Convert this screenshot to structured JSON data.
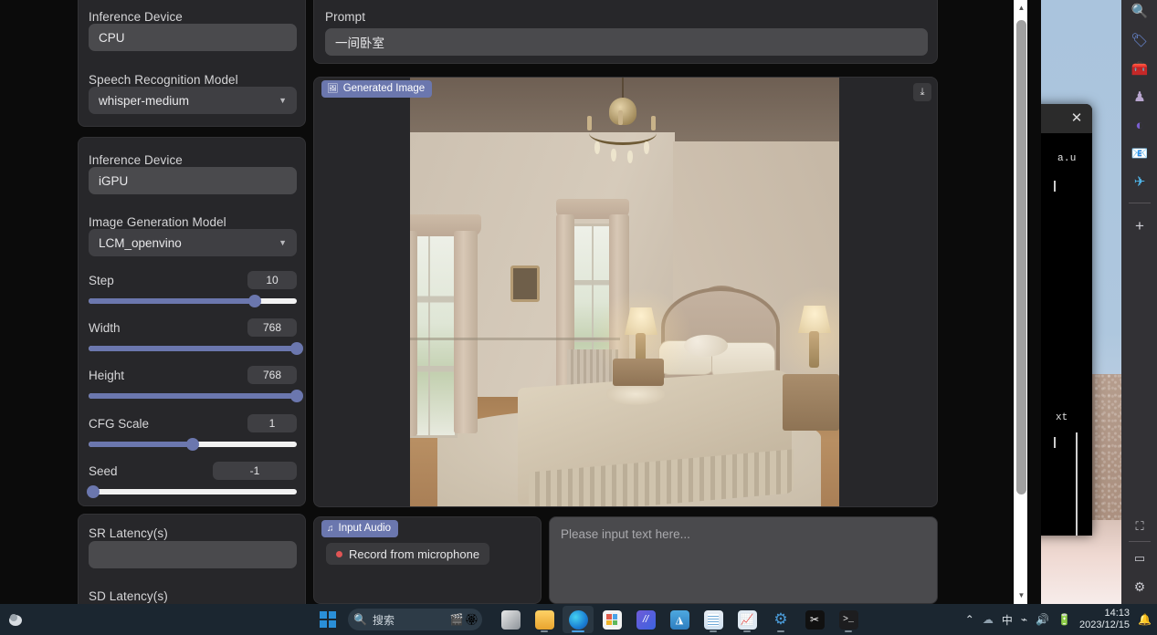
{
  "app": {
    "speech_panel": {
      "device_label": "Inference Device",
      "device_value": "CPU",
      "model_label": "Speech Recognition Model",
      "model_value": "whisper-medium"
    },
    "image_panel": {
      "device_label": "Inference Device",
      "device_value": "iGPU",
      "model_label": "Image Generation Model",
      "model_value": "LCM_openvino",
      "sliders": [
        {
          "label": "Step",
          "value": "10",
          "fill_pct": 80,
          "name": "step"
        },
        {
          "label": "Width",
          "value": "768",
          "fill_pct": 100,
          "name": "width"
        },
        {
          "label": "Height",
          "value": "768",
          "fill_pct": 100,
          "name": "height"
        },
        {
          "label": "CFG Scale",
          "value": "1",
          "fill_pct": 50,
          "name": "cfg-scale"
        },
        {
          "label": "Seed",
          "value": "-1",
          "fill_pct": 2,
          "name": "seed"
        }
      ]
    },
    "latency_panel": {
      "sr_label": "SR Latency(s)",
      "sr_value": "",
      "sd_label": "SD Latency(s)"
    },
    "prompt": {
      "label": "Prompt",
      "value": "一间卧室"
    },
    "generated_image": {
      "badge": "Generated Image",
      "badge_icon": "image-icon",
      "download_icon": "download-icon",
      "alt": "Classical beige bedroom with chandelier, two curtained windows, ornate wooden bed, table lamps and patterned rug"
    },
    "audio": {
      "badge": "Input Audio",
      "badge_icon": "music-note-icon",
      "record_label": "Record from microphone"
    },
    "textbox": {
      "placeholder": "Please input text here..."
    }
  },
  "bg_window": {
    "close_icon": "close-icon",
    "line1": "a.u",
    "line2": "xt"
  },
  "edge_sidebar": {
    "items": [
      {
        "name": "search-icon",
        "glyph": "🔍"
      },
      {
        "name": "shopping-tag-icon",
        "glyph": "🏷"
      },
      {
        "name": "tools-briefcase-icon",
        "glyph": "🧰"
      },
      {
        "name": "games-icon",
        "glyph": "♟"
      },
      {
        "name": "copilot-icon",
        "glyph": "◐"
      },
      {
        "name": "outlook-icon",
        "glyph": "O"
      },
      {
        "name": "telegram-icon",
        "glyph": "✈"
      },
      {
        "name": "add-icon",
        "glyph": "+"
      }
    ],
    "bottom_items": [
      {
        "name": "screenshot-icon",
        "glyph": "✂"
      },
      {
        "name": "split-screen-icon",
        "glyph": "▭"
      },
      {
        "name": "settings-gear-icon",
        "glyph": "⚙"
      }
    ]
  },
  "taskbar": {
    "weather_icon": "weather-cloud-icon",
    "start_icon": "windows-start-icon",
    "search_placeholder": "搜索",
    "search_icon": "search-icon",
    "items": [
      {
        "name": "task-view",
        "label": "Task View"
      },
      {
        "name": "file-explorer",
        "label": "File Explorer"
      },
      {
        "name": "microsoft-edge",
        "label": "Microsoft Edge"
      },
      {
        "name": "microsoft-store",
        "label": "Microsoft Store"
      },
      {
        "name": "app-blue-purple",
        "label": "App"
      },
      {
        "name": "app-blue",
        "label": "App"
      },
      {
        "name": "notepad",
        "label": "Notepad"
      },
      {
        "name": "performance-monitor",
        "label": "Performance"
      },
      {
        "name": "settings",
        "label": "Settings"
      },
      {
        "name": "capcut",
        "label": "CapCut"
      },
      {
        "name": "terminal",
        "label": "Terminal"
      }
    ],
    "tray": {
      "chevron_icon": "chevron-up-icon",
      "onedrive_icon": "onedrive-icon",
      "ime_label": "中",
      "wifi_icon": "wifi-icon",
      "volume_icon": "volume-icon",
      "battery_icon": "battery-icon",
      "time": "14:13",
      "date": "2023/12/15",
      "notification_icon": "bell-icon"
    }
  },
  "colors": {
    "accent": "#6b77ae",
    "panel": "#27272a",
    "field": "#4a4a4d",
    "page_bg": "#0b0b0b",
    "taskbar": "#1b2630"
  }
}
